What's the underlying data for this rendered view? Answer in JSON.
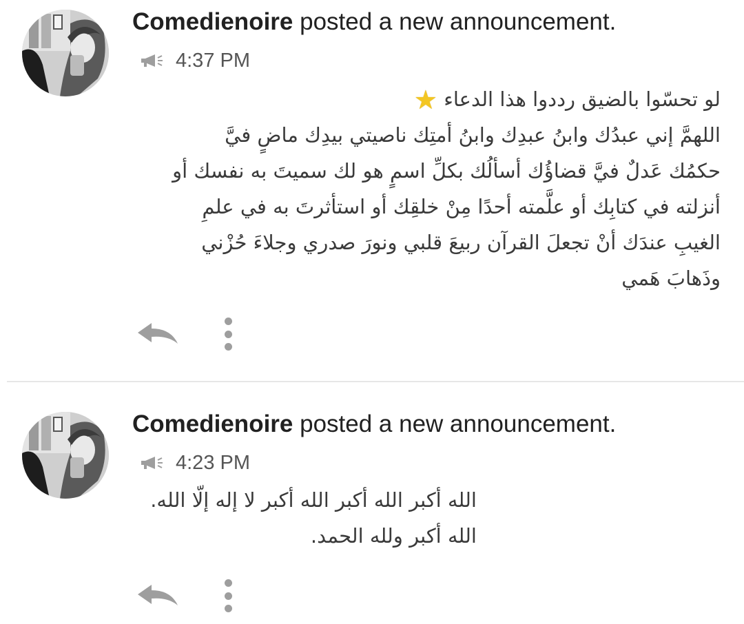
{
  "posts": [
    {
      "author": "Comedienoire",
      "action_text": " posted a new announcement.",
      "time": "4:37 PM",
      "body_lines": [
        "لو تحسّوا بالضيق رددوا هذا الدعاء",
        "اللهمَّ إني عبدُك وابنُ عبدِك وابنُ أمتِك ناصيتي بيدِك ماضٍ فيَّ",
        "حكمُك عَدلٌ فيَّ قضاؤُك أسألُك بكلِّ اسمٍ هو لك سميتَ به نفسك أو",
        "أنزلته في كتابِك أو علَّمته أحدًا مِنْ خلقِك أو استأثرتَ به في علمِ",
        "الغيبِ عندَك أنْ تجعلَ القرآن ربيعَ قلبي ونورَ صدري وجلاءَ حُزْني",
        "وذَهابَ هَمي"
      ],
      "icons": [
        "avatar",
        "megaphone-icon",
        "star-icon",
        "reply-icon",
        "more-vertical-icon"
      ]
    },
    {
      "author": "Comedienoire",
      "action_text": " posted a new announcement.",
      "time": "4:23 PM",
      "body_lines": [
        "الله أكبر الله أكبر الله أكبر لا إله إلّا الله.",
        "الله أكبر ولله الحمد."
      ],
      "icons": [
        "avatar",
        "megaphone-icon",
        "reply-icon",
        "more-vertical-icon"
      ]
    }
  ],
  "colors": {
    "text": "#212121",
    "meta": "#555555",
    "icon": "#9e9e9e",
    "star": "#f3c623",
    "divider": "#e6e6e6"
  }
}
